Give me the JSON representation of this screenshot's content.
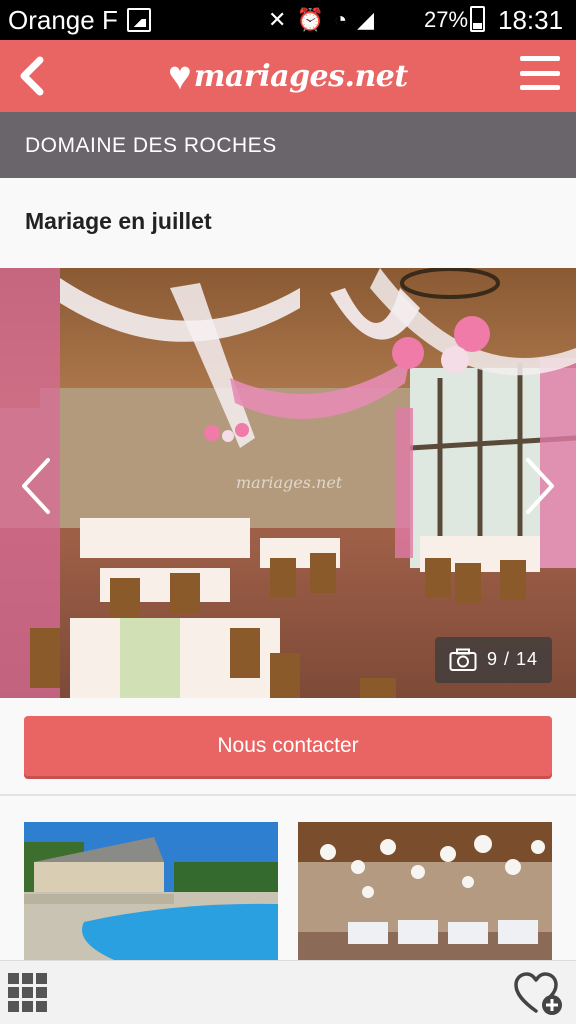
{
  "status_bar": {
    "carrier": "Orange F",
    "battery": "27%",
    "time": "18:31"
  },
  "header": {
    "logo_text": "mariages.net",
    "icons": {
      "back": "chevron-left-icon",
      "menu": "hamburger-menu-icon"
    },
    "color": "#e86563"
  },
  "venue": {
    "name": "DOMAINE DES ROCHES"
  },
  "photo": {
    "title": "Mariage en juillet",
    "watermark": "mariages.net",
    "counter": "9 / 14",
    "icons": {
      "prev": "chevron-left-icon",
      "next": "chevron-right-icon",
      "counter": "camera-icon"
    }
  },
  "contact": {
    "label": "Nous contacter"
  },
  "bottom_bar": {
    "icons": {
      "grid": "grid-menu-icon",
      "favorite": "heart-add-icon"
    }
  },
  "colors": {
    "accent": "#e86563",
    "venue_bar": "#6a656b"
  }
}
